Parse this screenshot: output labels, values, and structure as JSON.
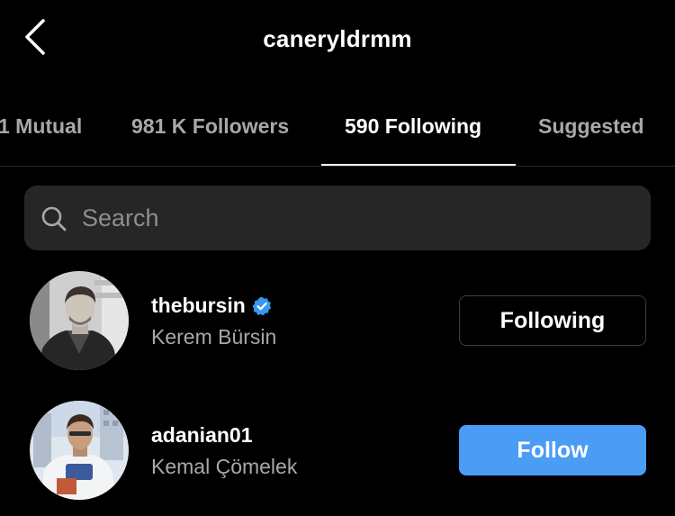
{
  "header": {
    "title": "caneryldrmm"
  },
  "tabs": [
    {
      "label": "1 Mutual",
      "active": false
    },
    {
      "label": "981 K Followers",
      "active": false
    },
    {
      "label": "590 Following",
      "active": true
    },
    {
      "label": "Suggested",
      "active": false
    }
  ],
  "search": {
    "placeholder": "Search",
    "value": ""
  },
  "users": [
    {
      "username": "thebursin",
      "full_name": "Kerem Bürsin",
      "verified": true,
      "button_label": "Following"
    },
    {
      "username": "adanian01",
      "full_name": "Kemal Çömelek",
      "verified": false,
      "button_label": "Follow"
    }
  ],
  "colors": {
    "background": "#000000",
    "primary_button": "#4a9cf5",
    "verified_badge": "#3897f0",
    "secondary_text": "#a8a8a8",
    "search_field": "#262626"
  }
}
